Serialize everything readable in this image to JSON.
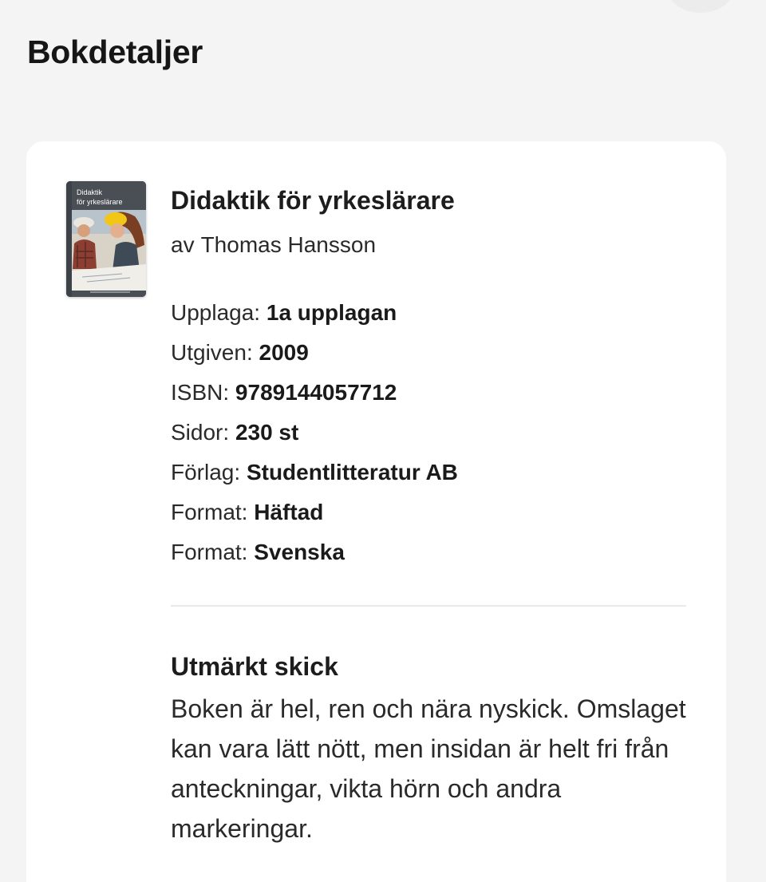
{
  "page": {
    "title": "Bokdetaljer"
  },
  "book": {
    "title": "Didaktik för yrkeslärare",
    "author_prefix": "av",
    "author": "Thomas Hansson",
    "cover": {
      "title_line1": "Didaktik",
      "title_line2": "för yrkeslärare",
      "colors": {
        "band": "#4a4e55",
        "hardhat": "#f2c617",
        "photo_bg": "#d9d3c7"
      }
    }
  },
  "details": [
    {
      "label": "Upplaga:",
      "value": "1a upplagan"
    },
    {
      "label": "Utgiven:",
      "value": "2009"
    },
    {
      "label": "ISBN:",
      "value": "9789144057712"
    },
    {
      "label": "Sidor:",
      "value": "230 st"
    },
    {
      "label": "Förlag:",
      "value": "Studentlitteratur AB"
    },
    {
      "label": "Format:",
      "value": "Häftad"
    },
    {
      "label": "Format:",
      "value": "Svenska"
    }
  ],
  "condition": {
    "title": "Utmärkt skick",
    "description": "Boken är hel, ren och nära nyskick. Omslaget kan vara lätt nött, men insidan är helt fri från anteckningar, vikta hörn och andra markeringar."
  }
}
